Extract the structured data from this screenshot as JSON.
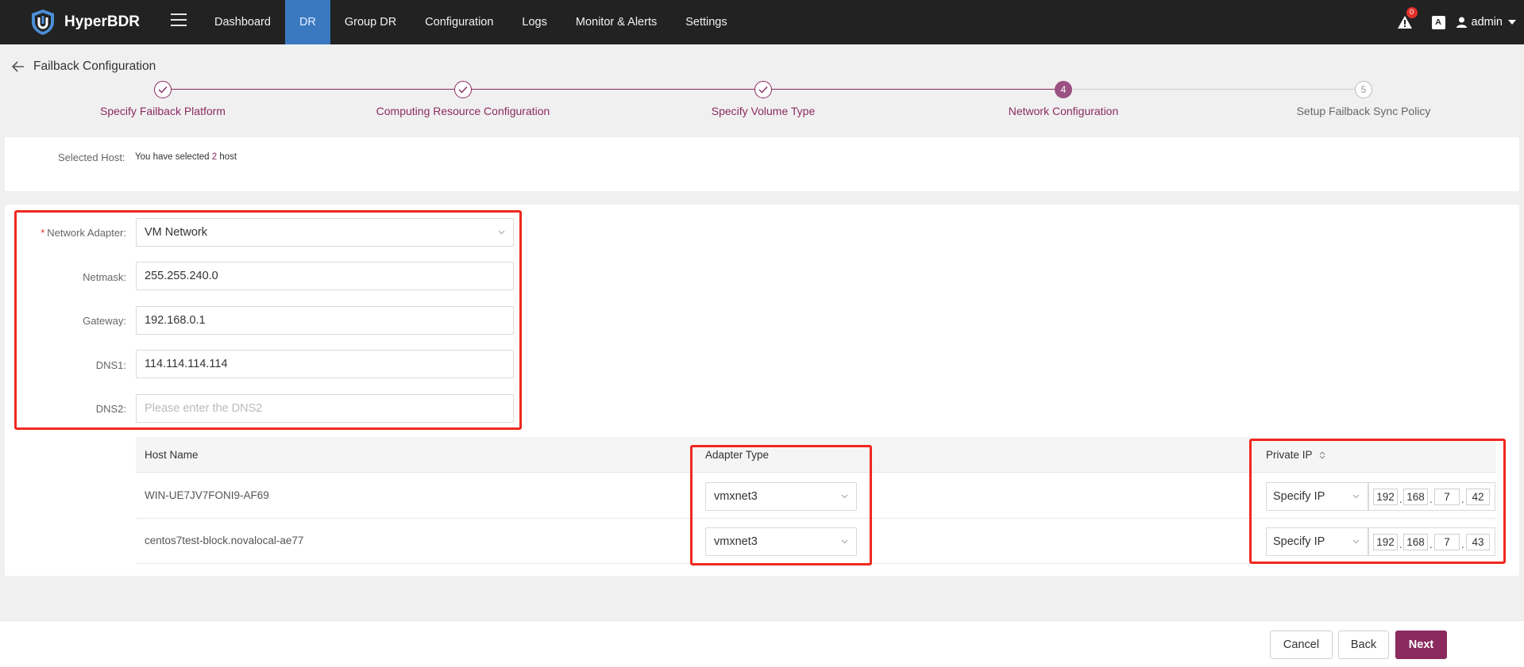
{
  "app": {
    "name": "HyperBDR",
    "nav": [
      "Dashboard",
      "DR",
      "Group DR",
      "Configuration",
      "Logs",
      "Monitor & Alerts",
      "Settings"
    ],
    "alert_count": "0",
    "lang_badge": "A文",
    "user": "admin",
    "accent_color": "#8b2a5f",
    "nav_active_color": "#3a78c0"
  },
  "page": {
    "title": "Failback Configuration"
  },
  "stepper": {
    "steps": [
      {
        "label": "Specify Failback Platform",
        "state": "done"
      },
      {
        "label": "Computing Resource Configuration",
        "state": "done"
      },
      {
        "label": "Specify Volume Type",
        "state": "done"
      },
      {
        "label": "Network Configuration",
        "state": "current",
        "number": "4"
      },
      {
        "label": "Setup Failback Sync Policy",
        "state": "todo",
        "number": "5"
      }
    ]
  },
  "selected": {
    "label": "Selected Host:",
    "prefix": "You have selected",
    "count": "2",
    "suffix": "host"
  },
  "form": {
    "network_adapter": {
      "label": "Network Adapter:",
      "value": "VM Network",
      "required": true
    },
    "netmask": {
      "label": "Netmask:",
      "value": "255.255.240.0"
    },
    "gateway": {
      "label": "Gateway:",
      "value": "192.168.0.1"
    },
    "dns1": {
      "label": "DNS1:",
      "value": "114.114.114.114"
    },
    "dns2": {
      "label": "DNS2:",
      "placeholder": "Please enter the DNS2"
    }
  },
  "table": {
    "columns": [
      "Host Name",
      "Adapter Type",
      "Private IP"
    ],
    "rows": [
      {
        "host": "WIN-UE7JV7FONI9-AF69",
        "adapter": "vmxnet3",
        "ip_mode": "Specify IP",
        "ip": [
          "192",
          "168",
          "7",
          "42"
        ]
      },
      {
        "host": "centos7test-block.novalocal-ae77",
        "adapter": "vmxnet3",
        "ip_mode": "Specify IP",
        "ip": [
          "192",
          "168",
          "7",
          "43"
        ]
      }
    ]
  },
  "footer": {
    "cancel": "Cancel",
    "back": "Back",
    "next": "Next"
  }
}
